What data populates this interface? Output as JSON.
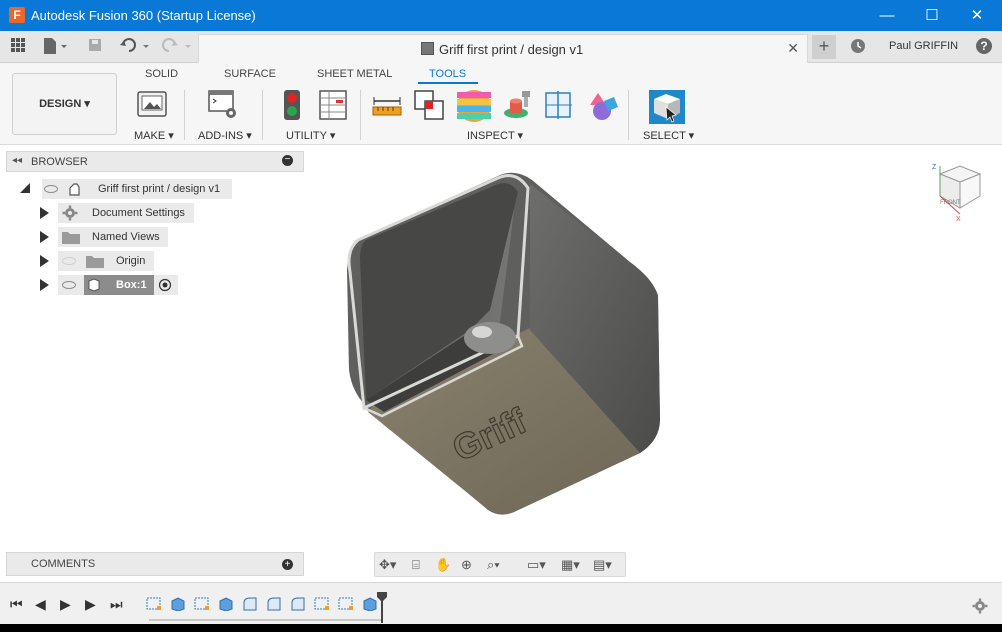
{
  "window": {
    "app_icon_letter": "F",
    "title": "Autodesk Fusion 360 (Startup License)",
    "minimize_glyph": "—",
    "maximize_glyph": "☐",
    "close_glyph": "✕"
  },
  "tabbar": {
    "document_title": "Griff first print / design v1",
    "close_glyph": "✕",
    "new_tab_glyph": "+",
    "user_name": "Paul GRIFFIN",
    "help_glyph": "?"
  },
  "ribbon": {
    "workspace_label": "DESIGN",
    "tabs": [
      {
        "label": "SOLID",
        "active": false
      },
      {
        "label": "SURFACE",
        "active": false
      },
      {
        "label": "SHEET METAL",
        "active": false
      },
      {
        "label": "TOOLS",
        "active": true
      }
    ],
    "groups": [
      {
        "label": "MAKE"
      },
      {
        "label": "ADD-INS"
      },
      {
        "label": "UTILITY"
      },
      {
        "label": "INSPECT"
      },
      {
        "label": "SELECT"
      }
    ],
    "accent_color": "#0a78d7"
  },
  "browser": {
    "title": "BROWSER",
    "root_label": "Griff first print / design v1",
    "items": [
      {
        "label": "Document Settings",
        "icon": "gear-icon"
      },
      {
        "label": "Named Views",
        "icon": "folder-icon"
      },
      {
        "label": "Origin",
        "icon": "folder-icon"
      },
      {
        "label": "Box:1",
        "icon": "body-icon",
        "selected": true
      }
    ]
  },
  "comments": {
    "title": "COMMENTS"
  },
  "viewport": {
    "model_text": "Griff",
    "viewcube_label": "FRONT"
  }
}
